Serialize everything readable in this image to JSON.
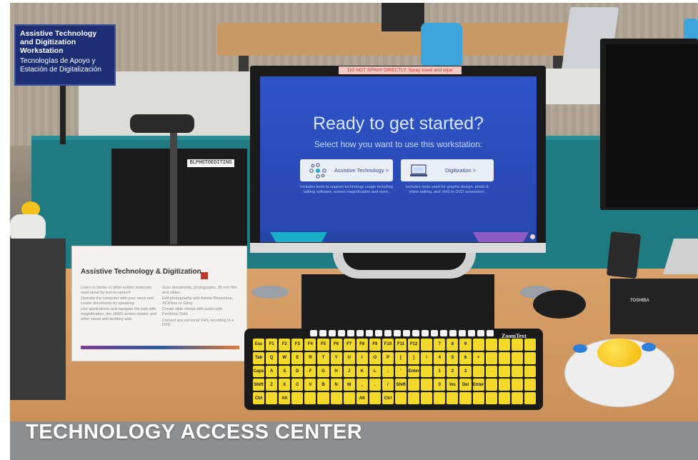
{
  "caption": "TECHNOLOGY ACCESS CENTER",
  "sign": {
    "title": "Assistive Technology and Digitization Workstation",
    "subtitle": "Tecnologías de Apoyo y Estación de Digitalización"
  },
  "monitor": {
    "warning_tape": "DO NOT SPRAY DIRECTLY. Spray towel and wipe",
    "heading": "Ready to get started?",
    "subheading": "Select how you want to use this workstation:",
    "options": [
      {
        "label": "Assistive Technology >",
        "description": "Includes tools to support technology usage including talking software, screen magnification and more."
      },
      {
        "label": "Digitization >",
        "description": "Includes tools used for graphic design, photo & video editing, and VHS to DVD conversion."
      }
    ]
  },
  "tower_label": "BLPHOTOEDITING",
  "card": {
    "title": "Assistive Technology & Digitization",
    "left_items": [
      "Listen to books or other written materials read aloud by text-to-speech",
      "Operate the computer with your voice and create documents by speaking",
      "Use applications and navigate the web with magnification, the JAWS screen reader and other visual and auditory aids"
    ],
    "right_items": [
      "Scan documents, photographs, 35 mm film and slides",
      "Edit photographs with Adobe Photoshop, ACDSee or Gimp",
      "Create slide shows with audio with ProShow Gold",
      "Convert any personal VHS recording to a DVD"
    ]
  },
  "keyboard_brand": "ZoomText",
  "vhs_brand": "TOSHIBA",
  "keys": [
    "Esc",
    "F1",
    "F2",
    "F3",
    "F4",
    "F5",
    "F6",
    "F7",
    "F8",
    "F9",
    "F10",
    "F11",
    "F12",
    "",
    "7",
    "8",
    "9",
    "",
    "",
    "",
    "",
    "",
    "Tab",
    "Q",
    "W",
    "E",
    "R",
    "T",
    "Y",
    "U",
    "I",
    "O",
    "P",
    "[",
    "]",
    "\\",
    "4",
    "5",
    "6",
    "+",
    "",
    "",
    "",
    "",
    "Caps",
    "A",
    "S",
    "D",
    "F",
    "G",
    "H",
    "J",
    "K",
    "L",
    ";",
    "'",
    "Enter",
    "",
    "1",
    "2",
    "3",
    "",
    "",
    "",
    "",
    "",
    "Shift",
    "Z",
    "X",
    "C",
    "V",
    "B",
    "N",
    "M",
    ",",
    ".",
    "/",
    "Shift",
    "",
    "",
    "0",
    "Ins",
    "Del",
    "Enter",
    "",
    "",
    "",
    "",
    "Ctrl",
    "",
    "Alt",
    "",
    "",
    "",
    "",
    "",
    "Alt",
    "",
    "Ctrl",
    "",
    "",
    "",
    "",
    "",
    "",
    "",
    "",
    "",
    "",
    ""
  ]
}
